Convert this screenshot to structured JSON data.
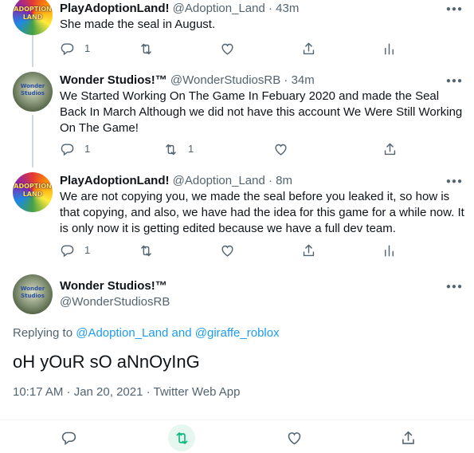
{
  "tweets": [
    {
      "avatar_text": "ADOPTION LAND",
      "name": "PlayAdoptionLand!",
      "handle": "@Adoption_Land",
      "time": "· 43m",
      "text": "She made the seal in August.",
      "replies": "1",
      "retweets": "",
      "likes": ""
    },
    {
      "avatar_text": "Wonder Studios",
      "name": "Wonder Studios!™",
      "handle": "@WonderStudiosRB",
      "time": "· 34m",
      "text": "We Started Working On The Game In Febuary 2020 and made the Seal Back In March Although we did not have this account We Were Still Working On The Game!",
      "replies": "1",
      "retweets": "1",
      "likes": ""
    },
    {
      "avatar_text": "ADOPTION LAND",
      "name": "PlayAdoptionLand!",
      "handle": "@Adoption_Land",
      "time": "· 8m",
      "text": "We are not copying you, we made the seal before you leaked it, so how is that copying, and also, we have had the idea for this game for a while now. It is only now it is getting edited because we have a full dev team.",
      "replies": "1",
      "retweets": "",
      "likes": ""
    }
  ],
  "main_tweet": {
    "avatar_text": "Wonder Studios",
    "name": "Wonder Studios!™",
    "handle": "@WonderStudiosRB",
    "replying_prefix": "Replying to ",
    "replying_user1": "@Adoption_Land",
    "replying_and": " and ",
    "replying_user2": "@giraffe_roblox",
    "text": "oH yOuR sO aNnOyInG",
    "timestamp": "10:17 AM · Jan 20, 2021 · Twitter Web App"
  },
  "icons": {
    "reply": "reply-icon",
    "retweet": "retweet-icon",
    "like": "heart-icon",
    "share": "share-icon",
    "analytics": "analytics-icon",
    "more": "more-icon"
  },
  "colors": {
    "accent": "#1d9bf0",
    "retweet_active": "#00ba7c",
    "secondary_text": "#536471"
  }
}
